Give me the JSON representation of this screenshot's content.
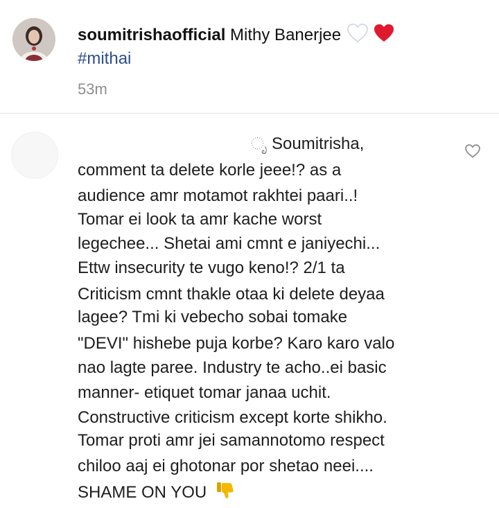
{
  "post": {
    "username": "soumitrishaofficial",
    "caption": "Mithy Banerjee",
    "hashtag": "#mithai",
    "time": "53m"
  },
  "comment": {
    "prefix_fragment": "ೃ",
    "lines": [
      "Soumitrisha,",
      "comment ta delete korle jeee!? as a",
      "audience amr motamot rakhtei paari..!",
      "Tomar ei look ta amr kache worst",
      "legechee... Shetai ami cmnt e janiyechi...",
      "Ettw insecurity te vugo keno!? 2/1 ta",
      "Criticism cmnt thakle otaa ki delete deyaa",
      "lagee? Tmi ki vebecho sobai tomake",
      "\"DEVI\" hishebe puja korbe? Karo karo valo",
      "nao lagte paree. Industry te acho..ei basic",
      "manner- etiquet tomar janaa uchit.",
      "Constructive criticism except korte shikho.",
      "Tomar proti amr jei samannotomo respect",
      "chiloo aaj ei ghotonar por shetao neei....",
      "SHAME ON YOU"
    ]
  },
  "icons": {
    "avatar": "profile-photo",
    "white_heart": "white-heart-emoji",
    "red_heart": "red-heart-emoji",
    "like": "heart-outline-icon",
    "thumbs_down": "thumbs-down-emoji"
  },
  "colors": {
    "hashtag": "#2b4f8c",
    "time": "#8e8e8e",
    "red_heart": "#e0192e",
    "thumbs_down": "#f5b800"
  }
}
